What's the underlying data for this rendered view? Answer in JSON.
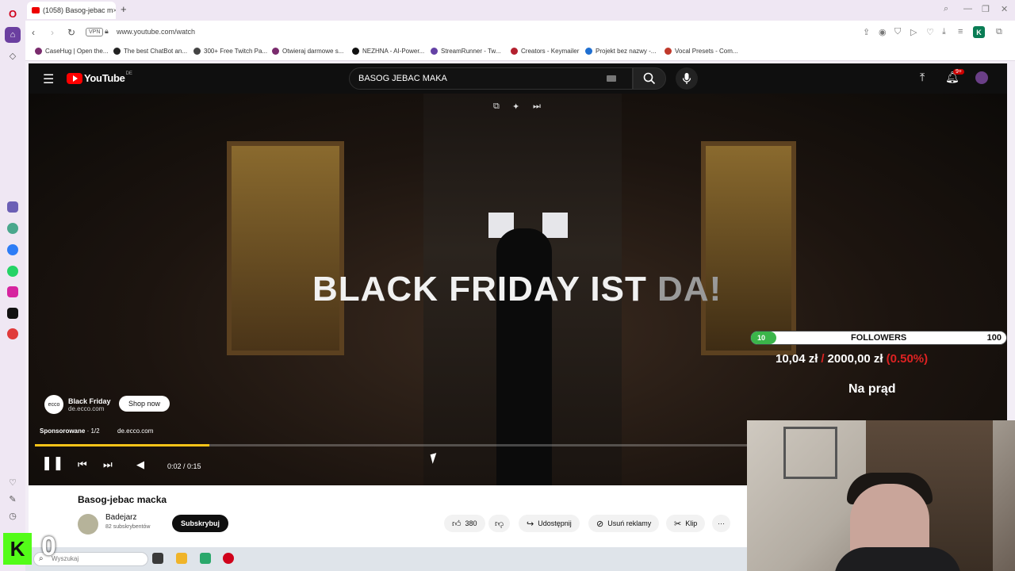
{
  "browser": {
    "tab_title": "(1058) Basog-jebac m",
    "new_tab": "+",
    "url": "www.youtube.com/watch",
    "vpn": "VPN",
    "extension_label": "K"
  },
  "bookmarks": [
    {
      "label": "CaseHug | Open the...",
      "color": "#7a2b6d"
    },
    {
      "label": "The best ChatBot an...",
      "color": "#222222"
    },
    {
      "label": "300+ Free Twitch Pa...",
      "color": "#444444"
    },
    {
      "label": "Otwieraj darmowe s...",
      "color": "#7a2b6d"
    },
    {
      "label": "NEZHNA - AI-Power...",
      "color": "#111111"
    },
    {
      "label": "StreamRunner - Tw...",
      "color": "#6441a5"
    },
    {
      "label": "Creators - Keymailer",
      "color": "#b3202e"
    },
    {
      "label": "Projekt bez nazwy -...",
      "color": "#1f6fd1"
    },
    {
      "label": "Vocal Presets - Com...",
      "color": "#c0392b"
    }
  ],
  "youtube": {
    "logo_text": "YouTube",
    "region": "DE",
    "search_value": "BASOG JEBAC MAKA",
    "notification_count": "9+"
  },
  "ad": {
    "headline_main": "BLACK FRIDAY IST ",
    "headline_fade": "DA!",
    "logo_text": "ecco",
    "advertiser": "Black Friday",
    "domain": "de.ecco.com",
    "cta": "Shop now",
    "sponsored": "Sponsorowane",
    "counter": " · 1/2",
    "sponsor_domain": "de.ecco.com",
    "progress": 0.245
  },
  "player": {
    "time": "0:02 / 0:15"
  },
  "overlay": {
    "followers_current": "10",
    "followers_label": "FOLLOWERS",
    "followers_goal": "100",
    "followers_progress": 0.1,
    "donation_current": "10,04 zł",
    "donation_sep": "/",
    "donation_goal": "2000,00 zł",
    "donation_pct": "(0.50%)",
    "status": "Na prąd"
  },
  "video": {
    "title": "Basog-jebac macka",
    "channel": "Badejarz",
    "subscribers": "82 subskrybentów",
    "subscribe_label": "Subskrybuj",
    "likes": "380",
    "share_label": "Udostępnij",
    "remove_ads_label": "Usuń reklamy",
    "clip_label": "Klip",
    "more": "···"
  },
  "taskbar": {
    "search_placeholder": "Wyszukaj"
  },
  "kick": {
    "logo": "K",
    "count": "0"
  },
  "colors": {
    "yt_red": "#ff0000",
    "progress_yellow": "#f7c318",
    "followers_green": "#3bb54a",
    "kick_green": "#53fc18"
  }
}
